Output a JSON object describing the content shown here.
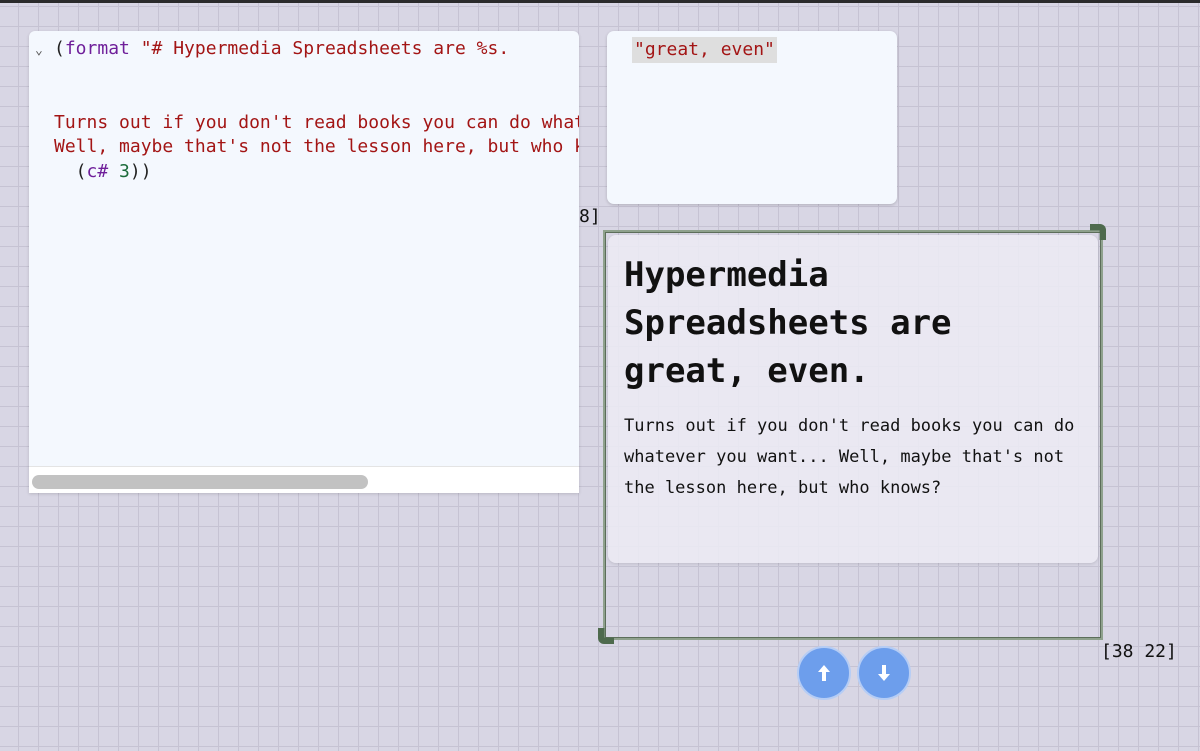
{
  "editor": {
    "fold_glyph": "⌄",
    "line1_paren": "(",
    "line1_keyword": "format",
    "line1_string": " \"# Hypermedia Spreadsheets are %s.",
    "line2": "",
    "line3": "",
    "line4": "Turns out if you don't read books you can do whatever you want...",
    "line5": "Well, maybe that's not the lesson here, but who knows?\"",
    "line6_open": "  (",
    "line6_keyword": "c#",
    "line6_num": "3",
    "line6_close": "))"
  },
  "value_cell": {
    "text": "\"great, even\""
  },
  "coords": {
    "partial": "8]",
    "selection": "[38 22]"
  },
  "preview": {
    "heading": "Hypermedia Spreadsheets are great, even.",
    "body": "Turns out if you don't read books you can do whatever you want... Well, maybe that's not the lesson here, but who knows?"
  },
  "icons": {
    "up": "arrow-up-icon",
    "down": "arrow-down-icon"
  },
  "colors": {
    "button": "#6d9eec",
    "selection_border": "#5c6e5a",
    "string": "#a31515",
    "keyword": "#6f1f9a"
  }
}
